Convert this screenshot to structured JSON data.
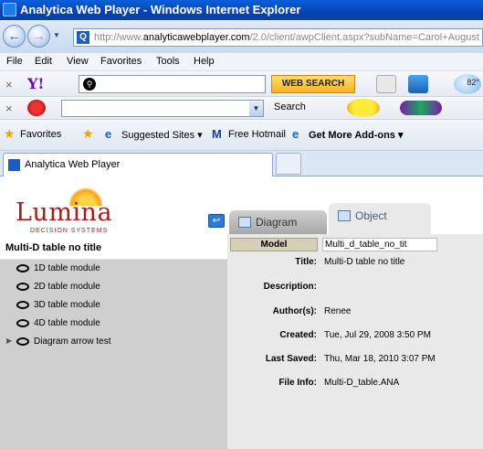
{
  "window": {
    "title": "Analytica Web Player - Windows Internet Explorer"
  },
  "address": {
    "url_prefix": "http://www.",
    "url_domain": "analyticawebplayer.com",
    "url_rest": "/2.0/client/awpClient.aspx?subName=Carol+August"
  },
  "menu": {
    "file": "File",
    "edit": "Edit",
    "view": "View",
    "favorites": "Favorites",
    "tools": "Tools",
    "help": "Help"
  },
  "yahoo_toolbar": {
    "logo": "Y!",
    "web_search": "WEB SEARCH",
    "weather": "82°"
  },
  "toolbar2": {
    "search_label": "Search"
  },
  "favorites_bar": {
    "favorites": "Favorites",
    "suggested_sites": "Suggested Sites",
    "free_hotmail": "Free Hotmail",
    "get_more_addons": "Get More Add-ons"
  },
  "browser_tab": {
    "label": "Analytica Web Player"
  },
  "logo": {
    "name": "Lumina",
    "subtitle": "DECISION SYSTEMS"
  },
  "tabs": {
    "diagram": "Diagram",
    "object": "Object"
  },
  "model_title": "Multi-D table no title",
  "tree": [
    {
      "label": "1D table module"
    },
    {
      "label": "2D table module"
    },
    {
      "label": "3D table module"
    },
    {
      "label": "4D table module"
    },
    {
      "label": "Diagram arrow test"
    }
  ],
  "object": {
    "model_label": "Model",
    "model_value": "Multi_d_table_no_tit",
    "title_label": "Title:",
    "title_value": "Multi-D table no title",
    "description_label": "Description:",
    "description_value": "",
    "authors_label": "Author(s):",
    "authors_value": "Renee",
    "created_label": "Created:",
    "created_value": "Tue, Jul 29, 2008 3:50 PM",
    "saved_label": "Last Saved:",
    "saved_value": "Thu, Mar 18, 2010 3:07 PM",
    "fileinfo_label": "File Info:",
    "fileinfo_value": "Multi-D_table.ANA"
  }
}
